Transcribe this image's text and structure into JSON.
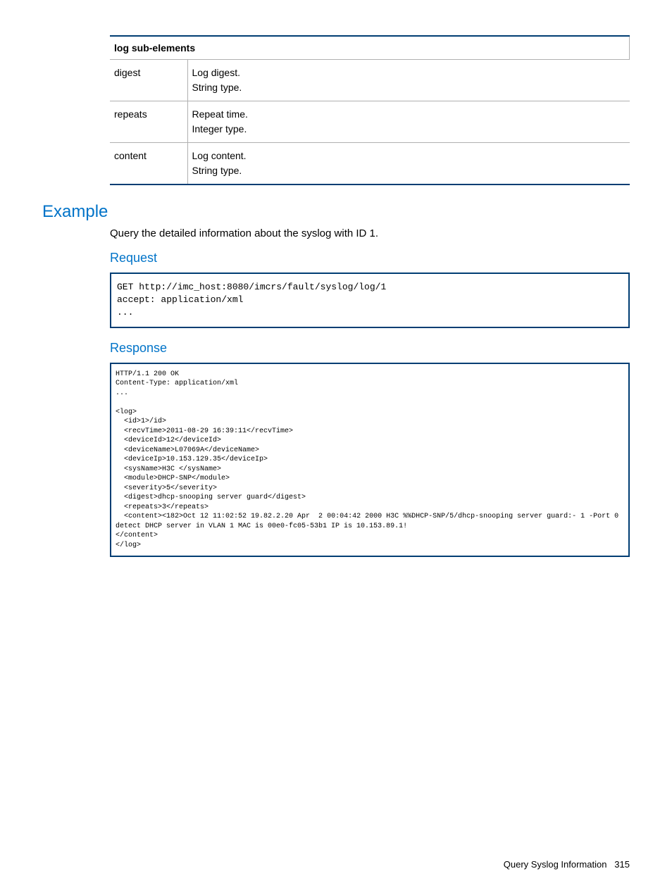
{
  "table": {
    "header": "log sub-elements",
    "rows": [
      {
        "name": "digest",
        "desc": "Log digest.\nString type."
      },
      {
        "name": "repeats",
        "desc": "Repeat time.\nInteger type."
      },
      {
        "name": "content",
        "desc": "Log content.\nString type."
      }
    ]
  },
  "example": {
    "heading": "Example",
    "intro": "Query the detailed information about the syslog with ID 1.",
    "request_heading": "Request",
    "request_code": "GET http://imc_host:8080/imcrs/fault/syslog/log/1\naccept: application/xml\n...",
    "response_heading": "Response",
    "response_code": "HTTP/1.1 200 OK\nContent-Type: application/xml\n...\n\n<log>\n  <id>1>/id>\n  <recvTime>2011-08-29 16:39:11</recvTime>\n  <deviceId>12</deviceId>\n  <deviceName>L07069A</deviceName>\n  <deviceIp>10.153.129.35</deviceIp>\n  <sysName>H3C </sysName>\n  <module>DHCP-SNP</module>\n  <severity>5</severity>\n  <digest>dhcp-snooping server guard</digest>\n  <repeats>3</repeats>\n  <content><182>Oct 12 11:02:52 19.82.2.20 Apr  2 00:04:42 2000 H3C %%DHCP-SNP/5/dhcp-snooping server guard:- 1 -Port 0 detect DHCP server in VLAN 1 MAC is 00e0-fc05-53b1 IP is 10.153.89.1!\n</content>\n</log>"
  },
  "footer": {
    "title": "Query Syslog Information",
    "page": "315"
  }
}
